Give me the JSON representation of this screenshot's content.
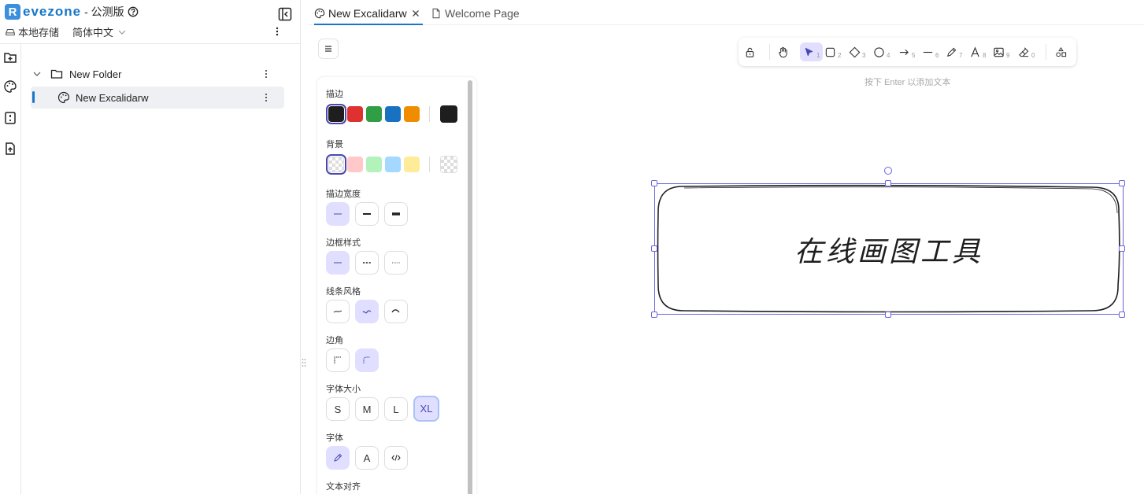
{
  "brand": {
    "logo_letter": "R",
    "name": "evezone",
    "edition": "- 公测版"
  },
  "sidebar": {
    "storage_label": "本地存储",
    "language": "简体中文",
    "tree": [
      {
        "type": "folder",
        "label": "New Folder",
        "expanded": true
      },
      {
        "type": "file",
        "label": "New Excalidarw",
        "active": true
      }
    ]
  },
  "tabs": [
    {
      "label": "New Excalidarw",
      "active": true
    },
    {
      "label": "Welcome Page",
      "active": false
    }
  ],
  "toolbar": {
    "tools": [
      {
        "name": "lock",
        "key": ""
      },
      {
        "name": "hand",
        "key": ""
      },
      {
        "name": "selection",
        "key": "1",
        "selected": true
      },
      {
        "name": "rectangle",
        "key": "2"
      },
      {
        "name": "diamond",
        "key": "3"
      },
      {
        "name": "ellipse",
        "key": "4"
      },
      {
        "name": "arrow",
        "key": "5"
      },
      {
        "name": "line",
        "key": "6"
      },
      {
        "name": "pencil",
        "key": "7"
      },
      {
        "name": "text",
        "key": "8"
      },
      {
        "name": "image",
        "key": "9"
      },
      {
        "name": "eraser",
        "key": "0"
      },
      {
        "name": "library",
        "key": ""
      }
    ]
  },
  "hint": "按下 Enter 以添加文本",
  "panel": {
    "stroke": {
      "title": "描边",
      "colors": [
        "#1e1e1e",
        "#e03131",
        "#2f9e44",
        "#1971c2",
        "#f08c00"
      ],
      "current": "#1e1e1e"
    },
    "background": {
      "title": "背景",
      "colors": [
        "transparent",
        "#ffc9c9",
        "#b2f2bb",
        "#a5d8ff",
        "#ffec99"
      ],
      "current": "transparent"
    },
    "stroke_width": {
      "title": "描边宽度"
    },
    "stroke_style": {
      "title": "边框样式"
    },
    "sloppiness": {
      "title": "线条风格"
    },
    "edges": {
      "title": "边角"
    },
    "font_size": {
      "title": "字体大小",
      "options": [
        "S",
        "M",
        "L",
        "XL"
      ],
      "selected": "XL"
    },
    "font_family": {
      "title": "字体",
      "hand_glyph": "A"
    },
    "text_align": {
      "title": "文本对齐"
    }
  },
  "canvas": {
    "shape_text": "在线画图工具"
  }
}
